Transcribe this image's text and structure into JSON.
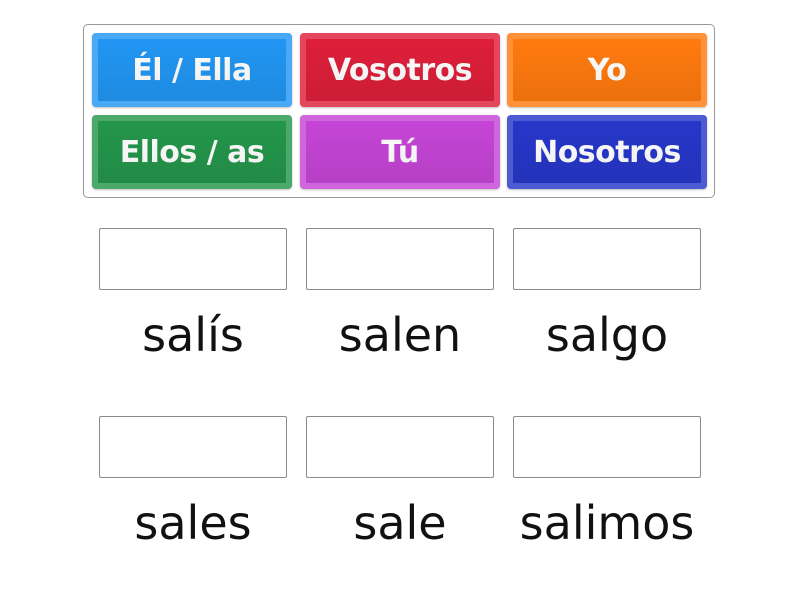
{
  "tiles": [
    {
      "label": "Él / Ella",
      "color": "#2196f3"
    },
    {
      "label": "Vosotros",
      "color": "#de1f3a"
    },
    {
      "label": "Yo",
      "color": "#ff7a0e"
    },
    {
      "label": "Ellos / as",
      "color": "#24964b"
    },
    {
      "label": "Tú",
      "color": "#c545d6"
    },
    {
      "label": "Nosotros",
      "color": "#2637c9"
    }
  ],
  "targets": [
    {
      "word": "salís",
      "answer": ""
    },
    {
      "word": "salen",
      "answer": ""
    },
    {
      "word": "salgo",
      "answer": ""
    },
    {
      "word": "sales",
      "answer": ""
    },
    {
      "word": "sale",
      "answer": ""
    },
    {
      "word": "salimos",
      "answer": ""
    }
  ]
}
